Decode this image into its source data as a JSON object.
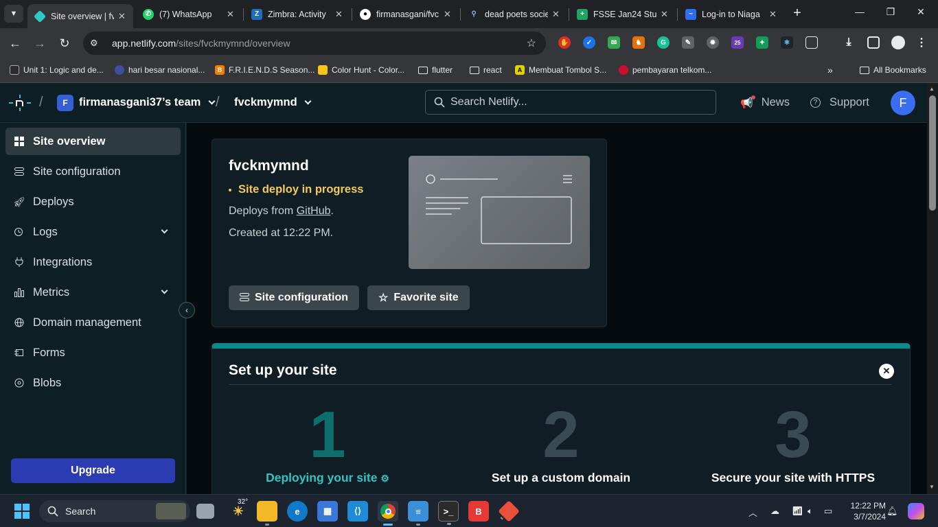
{
  "browser": {
    "tabs": [
      {
        "title": "Site overview | fv",
        "active": true
      },
      {
        "title": "(7) WhatsApp"
      },
      {
        "title": "Zimbra: Activity"
      },
      {
        "title": "firmanasgani/fvc"
      },
      {
        "title": "dead poets socie"
      },
      {
        "title": "FSSE Jan24 Stud"
      },
      {
        "title": "Log-in to Niaga"
      }
    ],
    "url_host": "app.netlify.com",
    "url_path": "/sites/fvckmymnd/overview",
    "bookmarks": [
      "Unit 1: Logic and de...",
      "hari besar nasional...",
      "F.R.I.E.N.D.S Season...",
      "Color Hunt - Color...",
      "flutter",
      "react",
      "Membuat Tombol S...",
      "pembayaran telkom...",
      "All Bookmarks"
    ],
    "extension_badge": "25"
  },
  "header": {
    "team_initial": "F",
    "team_name": "firmanasgani37’s team",
    "site_name": "fvckmymnd",
    "search_placeholder": "Search Netlify...",
    "news": "News",
    "support": "Support",
    "user_initial": "F"
  },
  "sidebar": {
    "items": [
      {
        "label": "Site overview",
        "icon": "grid-icon"
      },
      {
        "label": "Site configuration",
        "icon": "sliders-icon"
      },
      {
        "label": "Deploys",
        "icon": "rocket-icon"
      },
      {
        "label": "Logs",
        "icon": "logs-icon"
      },
      {
        "label": "Integrations",
        "icon": "plug-icon"
      },
      {
        "label": "Metrics",
        "icon": "bar-chart-icon"
      },
      {
        "label": "Domain management",
        "icon": "globe-icon"
      },
      {
        "label": "Forms",
        "icon": "form-icon"
      },
      {
        "label": "Blobs",
        "icon": "database-icon"
      }
    ],
    "upgrade": "Upgrade"
  },
  "overview": {
    "site_name": "fvckmymnd",
    "status": "Site deploy in progress",
    "deploys_prefix": "Deploys from ",
    "deploys_link": "GitHub",
    "deploys_suffix": ".",
    "created": "Created at 12:22 PM.",
    "config_button": "Site configuration",
    "favorite_button": "Favorite site"
  },
  "setup": {
    "title": "Set up your site",
    "steps": [
      {
        "number": "1",
        "label": "Deploying your site"
      },
      {
        "number": "2",
        "label": "Set up a custom domain"
      },
      {
        "number": "3",
        "label": "Secure your site with HTTPS"
      }
    ]
  },
  "taskbar": {
    "weather_temp": "32°",
    "search_label": "Search",
    "time": "12:22 PM",
    "date": "3/7/2024"
  },
  "colors": {
    "accent_teal": "#32c3c3",
    "status_yellow": "#f2c95d",
    "upgrade_blue": "#2b3bb1"
  }
}
